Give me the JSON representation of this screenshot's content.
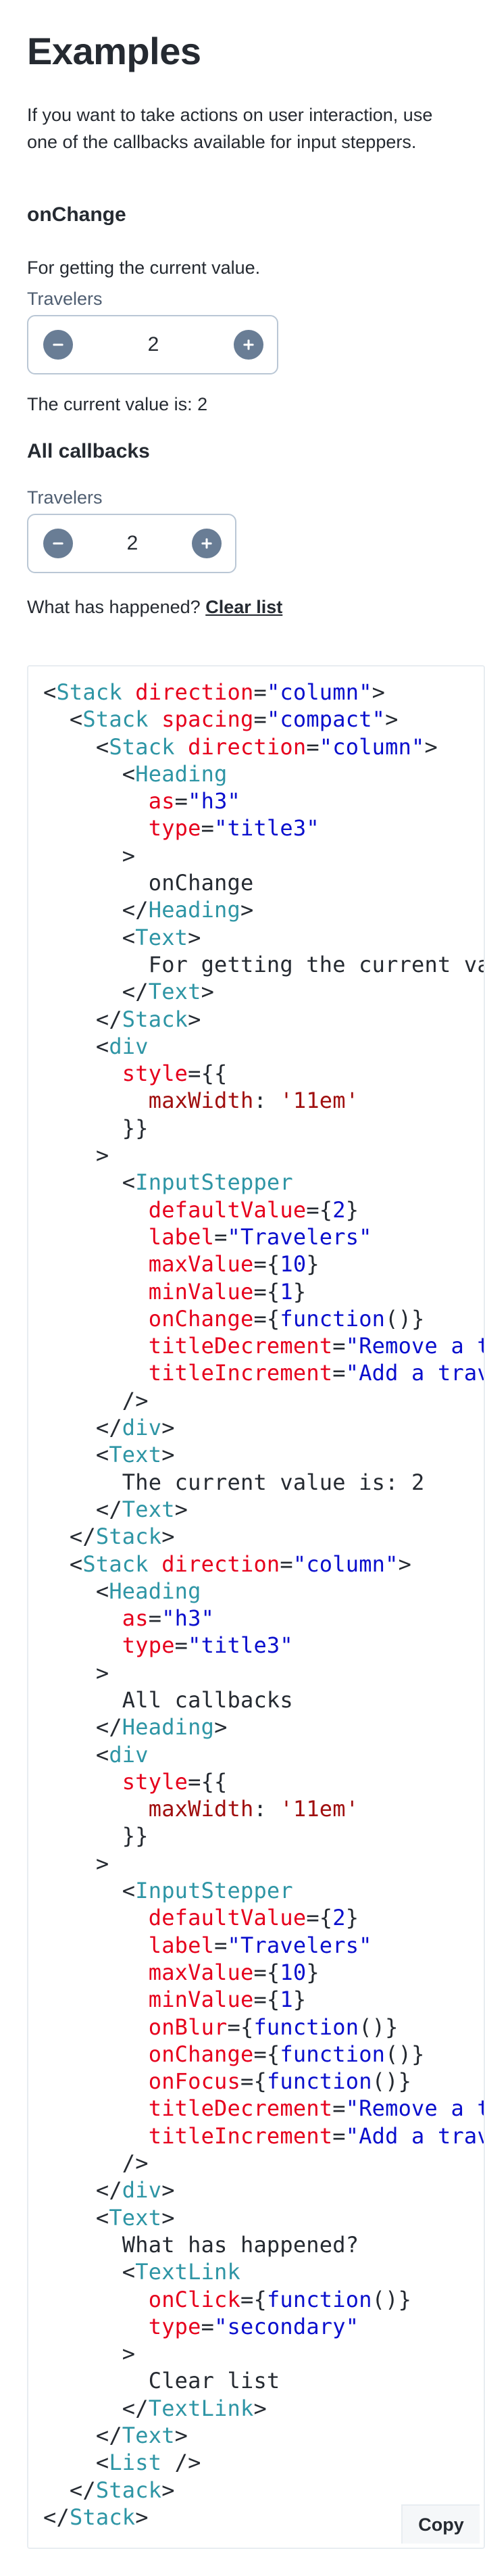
{
  "page": {
    "title": "Examples",
    "intro": "If you want to take actions on user interaction, use one of the callbacks available for input steppers."
  },
  "on_change_example": {
    "heading": "onChange",
    "description": "For getting the current value.",
    "stepper_label": "Travelers",
    "stepper_value": "2",
    "current_value_text": "The current value is: 2"
  },
  "all_callbacks_example": {
    "heading": "All callbacks",
    "stepper_label": "Travelers",
    "stepper_value": "2",
    "what_happened": "What has happened?",
    "clear_link": "Clear list"
  },
  "code": {
    "copy_label": "Copy",
    "lines": [
      [
        [
          "p",
          "<"
        ],
        [
          "t",
          "Stack"
        ],
        [
          "p",
          " "
        ],
        [
          "a",
          "direction"
        ],
        [
          "p",
          "="
        ],
        [
          "s",
          "\"column\""
        ],
        [
          "p",
          ">"
        ]
      ],
      [
        [
          "p",
          "  <"
        ],
        [
          "t",
          "Stack"
        ],
        [
          "p",
          " "
        ],
        [
          "a",
          "spacing"
        ],
        [
          "p",
          "="
        ],
        [
          "s",
          "\"compact\""
        ],
        [
          "p",
          ">"
        ]
      ],
      [
        [
          "p",
          "    <"
        ],
        [
          "t",
          "Stack"
        ],
        [
          "p",
          " "
        ],
        [
          "a",
          "direction"
        ],
        [
          "p",
          "="
        ],
        [
          "s",
          "\"column\""
        ],
        [
          "p",
          ">"
        ]
      ],
      [
        [
          "p",
          "      <"
        ],
        [
          "t",
          "Heading"
        ]
      ],
      [
        [
          "p",
          "        "
        ],
        [
          "a",
          "as"
        ],
        [
          "p",
          "="
        ],
        [
          "s",
          "\"h3\""
        ]
      ],
      [
        [
          "p",
          "        "
        ],
        [
          "a",
          "type"
        ],
        [
          "p",
          "="
        ],
        [
          "s",
          "\"title3\""
        ]
      ],
      [
        [
          "p",
          "      >"
        ]
      ],
      [
        [
          "p",
          "        onChange"
        ]
      ],
      [
        [
          "p",
          "      </"
        ],
        [
          "t",
          "Heading"
        ],
        [
          "p",
          ">"
        ]
      ],
      [
        [
          "p",
          "      <"
        ],
        [
          "t",
          "Text"
        ],
        [
          "p",
          ">"
        ]
      ],
      [
        [
          "p",
          "        For getting the current value."
        ]
      ],
      [
        [
          "p",
          "      </"
        ],
        [
          "t",
          "Text"
        ],
        [
          "p",
          ">"
        ]
      ],
      [
        [
          "p",
          "    </"
        ],
        [
          "t",
          "Stack"
        ],
        [
          "p",
          ">"
        ]
      ],
      [
        [
          "p",
          "    <"
        ],
        [
          "t",
          "div"
        ]
      ],
      [
        [
          "p",
          "      "
        ],
        [
          "a",
          "style"
        ],
        [
          "p",
          "={{"
        ]
      ],
      [
        [
          "p",
          "        "
        ],
        [
          "e",
          "maxWidth"
        ],
        [
          "p",
          ": "
        ],
        [
          "e",
          "'11em'"
        ]
      ],
      [
        [
          "p",
          "      }}"
        ]
      ],
      [
        [
          "p",
          "    >"
        ]
      ],
      [
        [
          "p",
          "      <"
        ],
        [
          "t",
          "InputStepper"
        ]
      ],
      [
        [
          "p",
          "        "
        ],
        [
          "a",
          "defaultValue"
        ],
        [
          "p",
          "={"
        ],
        [
          "s",
          "2"
        ],
        [
          "p",
          "}"
        ]
      ],
      [
        [
          "p",
          "        "
        ],
        [
          "a",
          "label"
        ],
        [
          "p",
          "="
        ],
        [
          "s",
          "\"Travelers\""
        ]
      ],
      [
        [
          "p",
          "        "
        ],
        [
          "a",
          "maxValue"
        ],
        [
          "p",
          "={"
        ],
        [
          "s",
          "10"
        ],
        [
          "p",
          "}"
        ]
      ],
      [
        [
          "p",
          "        "
        ],
        [
          "a",
          "minValue"
        ],
        [
          "p",
          "={"
        ],
        [
          "s",
          "1"
        ],
        [
          "p",
          "}"
        ]
      ],
      [
        [
          "p",
          "        "
        ],
        [
          "a",
          "onChange"
        ],
        [
          "p",
          "={"
        ],
        [
          "s",
          "function"
        ],
        [
          "p",
          "()}"
        ]
      ],
      [
        [
          "p",
          "        "
        ],
        [
          "a",
          "titleDecrement"
        ],
        [
          "p",
          "="
        ],
        [
          "s",
          "\"Remove a traveler\""
        ]
      ],
      [
        [
          "p",
          "        "
        ],
        [
          "a",
          "titleIncrement"
        ],
        [
          "p",
          "="
        ],
        [
          "s",
          "\"Add a traveler\""
        ]
      ],
      [
        [
          "p",
          "      />"
        ]
      ],
      [
        [
          "p",
          "    </"
        ],
        [
          "t",
          "div"
        ],
        [
          "p",
          ">"
        ]
      ],
      [
        [
          "p",
          "    <"
        ],
        [
          "t",
          "Text"
        ],
        [
          "p",
          ">"
        ]
      ],
      [
        [
          "p",
          "      The current value is: 2"
        ]
      ],
      [
        [
          "p",
          "    </"
        ],
        [
          "t",
          "Text"
        ],
        [
          "p",
          ">"
        ]
      ],
      [
        [
          "p",
          "  </"
        ],
        [
          "t",
          "Stack"
        ],
        [
          "p",
          ">"
        ]
      ],
      [
        [
          "p",
          "  <"
        ],
        [
          "t",
          "Stack"
        ],
        [
          "p",
          " "
        ],
        [
          "a",
          "direction"
        ],
        [
          "p",
          "="
        ],
        [
          "s",
          "\"column\""
        ],
        [
          "p",
          ">"
        ]
      ],
      [
        [
          "p",
          "    <"
        ],
        [
          "t",
          "Heading"
        ]
      ],
      [
        [
          "p",
          "      "
        ],
        [
          "a",
          "as"
        ],
        [
          "p",
          "="
        ],
        [
          "s",
          "\"h3\""
        ]
      ],
      [
        [
          "p",
          "      "
        ],
        [
          "a",
          "type"
        ],
        [
          "p",
          "="
        ],
        [
          "s",
          "\"title3\""
        ]
      ],
      [
        [
          "p",
          "    >"
        ]
      ],
      [
        [
          "p",
          "      All callbacks"
        ]
      ],
      [
        [
          "p",
          "    </"
        ],
        [
          "t",
          "Heading"
        ],
        [
          "p",
          ">"
        ]
      ],
      [
        [
          "p",
          "    <"
        ],
        [
          "t",
          "div"
        ]
      ],
      [
        [
          "p",
          "      "
        ],
        [
          "a",
          "style"
        ],
        [
          "p",
          "={{"
        ]
      ],
      [
        [
          "p",
          "        "
        ],
        [
          "e",
          "maxWidth"
        ],
        [
          "p",
          ": "
        ],
        [
          "e",
          "'11em'"
        ]
      ],
      [
        [
          "p",
          "      }}"
        ]
      ],
      [
        [
          "p",
          "    >"
        ]
      ],
      [
        [
          "p",
          "      <"
        ],
        [
          "t",
          "InputStepper"
        ]
      ],
      [
        [
          "p",
          "        "
        ],
        [
          "a",
          "defaultValue"
        ],
        [
          "p",
          "={"
        ],
        [
          "s",
          "2"
        ],
        [
          "p",
          "}"
        ]
      ],
      [
        [
          "p",
          "        "
        ],
        [
          "a",
          "label"
        ],
        [
          "p",
          "="
        ],
        [
          "s",
          "\"Travelers\""
        ]
      ],
      [
        [
          "p",
          "        "
        ],
        [
          "a",
          "maxValue"
        ],
        [
          "p",
          "={"
        ],
        [
          "s",
          "10"
        ],
        [
          "p",
          "}"
        ]
      ],
      [
        [
          "p",
          "        "
        ],
        [
          "a",
          "minValue"
        ],
        [
          "p",
          "={"
        ],
        [
          "s",
          "1"
        ],
        [
          "p",
          "}"
        ]
      ],
      [
        [
          "p",
          "        "
        ],
        [
          "a",
          "onBlur"
        ],
        [
          "p",
          "={"
        ],
        [
          "s",
          "function"
        ],
        [
          "p",
          "()}"
        ]
      ],
      [
        [
          "p",
          "        "
        ],
        [
          "a",
          "onChange"
        ],
        [
          "p",
          "={"
        ],
        [
          "s",
          "function"
        ],
        [
          "p",
          "()}"
        ]
      ],
      [
        [
          "p",
          "        "
        ],
        [
          "a",
          "onFocus"
        ],
        [
          "p",
          "={"
        ],
        [
          "s",
          "function"
        ],
        [
          "p",
          "()}"
        ]
      ],
      [
        [
          "p",
          "        "
        ],
        [
          "a",
          "titleDecrement"
        ],
        [
          "p",
          "="
        ],
        [
          "s",
          "\"Remove a traveler\""
        ]
      ],
      [
        [
          "p",
          "        "
        ],
        [
          "a",
          "titleIncrement"
        ],
        [
          "p",
          "="
        ],
        [
          "s",
          "\"Add a traveler\""
        ]
      ],
      [
        [
          "p",
          "      />"
        ]
      ],
      [
        [
          "p",
          "    </"
        ],
        [
          "t",
          "div"
        ],
        [
          "p",
          ">"
        ]
      ],
      [
        [
          "p",
          "    <"
        ],
        [
          "t",
          "Text"
        ],
        [
          "p",
          ">"
        ]
      ],
      [
        [
          "p",
          "      What has happened?"
        ]
      ],
      [
        [
          "p",
          "      <"
        ],
        [
          "t",
          "TextLink"
        ]
      ],
      [
        [
          "p",
          "        "
        ],
        [
          "a",
          "onClick"
        ],
        [
          "p",
          "={"
        ],
        [
          "s",
          "function"
        ],
        [
          "p",
          "()}"
        ]
      ],
      [
        [
          "p",
          "        "
        ],
        [
          "a",
          "type"
        ],
        [
          "p",
          "="
        ],
        [
          "s",
          "\"secondary\""
        ]
      ],
      [
        [
          "p",
          "      >"
        ]
      ],
      [
        [
          "p",
          "        Clear list"
        ]
      ],
      [
        [
          "p",
          "      </"
        ],
        [
          "t",
          "TextLink"
        ],
        [
          "p",
          ">"
        ]
      ],
      [
        [
          "p",
          "    </"
        ],
        [
          "t",
          "Text"
        ],
        [
          "p",
          ">"
        ]
      ],
      [
        [
          "p",
          "    <"
        ],
        [
          "t",
          "List"
        ],
        [
          "p",
          " />"
        ]
      ],
      [
        [
          "p",
          "  </"
        ],
        [
          "t",
          "Stack"
        ],
        [
          "p",
          ">"
        ]
      ],
      [
        [
          "p",
          "</"
        ],
        [
          "t",
          "Stack"
        ],
        [
          "p",
          ">"
        ]
      ]
    ]
  },
  "icons": {
    "decrement": "minus-circle-icon",
    "increment": "plus-circle-icon"
  },
  "colors": {
    "text": "#252a31",
    "label": "#4f5e71",
    "stepper_border": "#bac7d5",
    "stepper_button": "#697d95",
    "code_tag": "#2e95a5",
    "code_attr": "#e6001c",
    "code_string": "#0a0fcd",
    "code_expr": "#a00f0f"
  }
}
